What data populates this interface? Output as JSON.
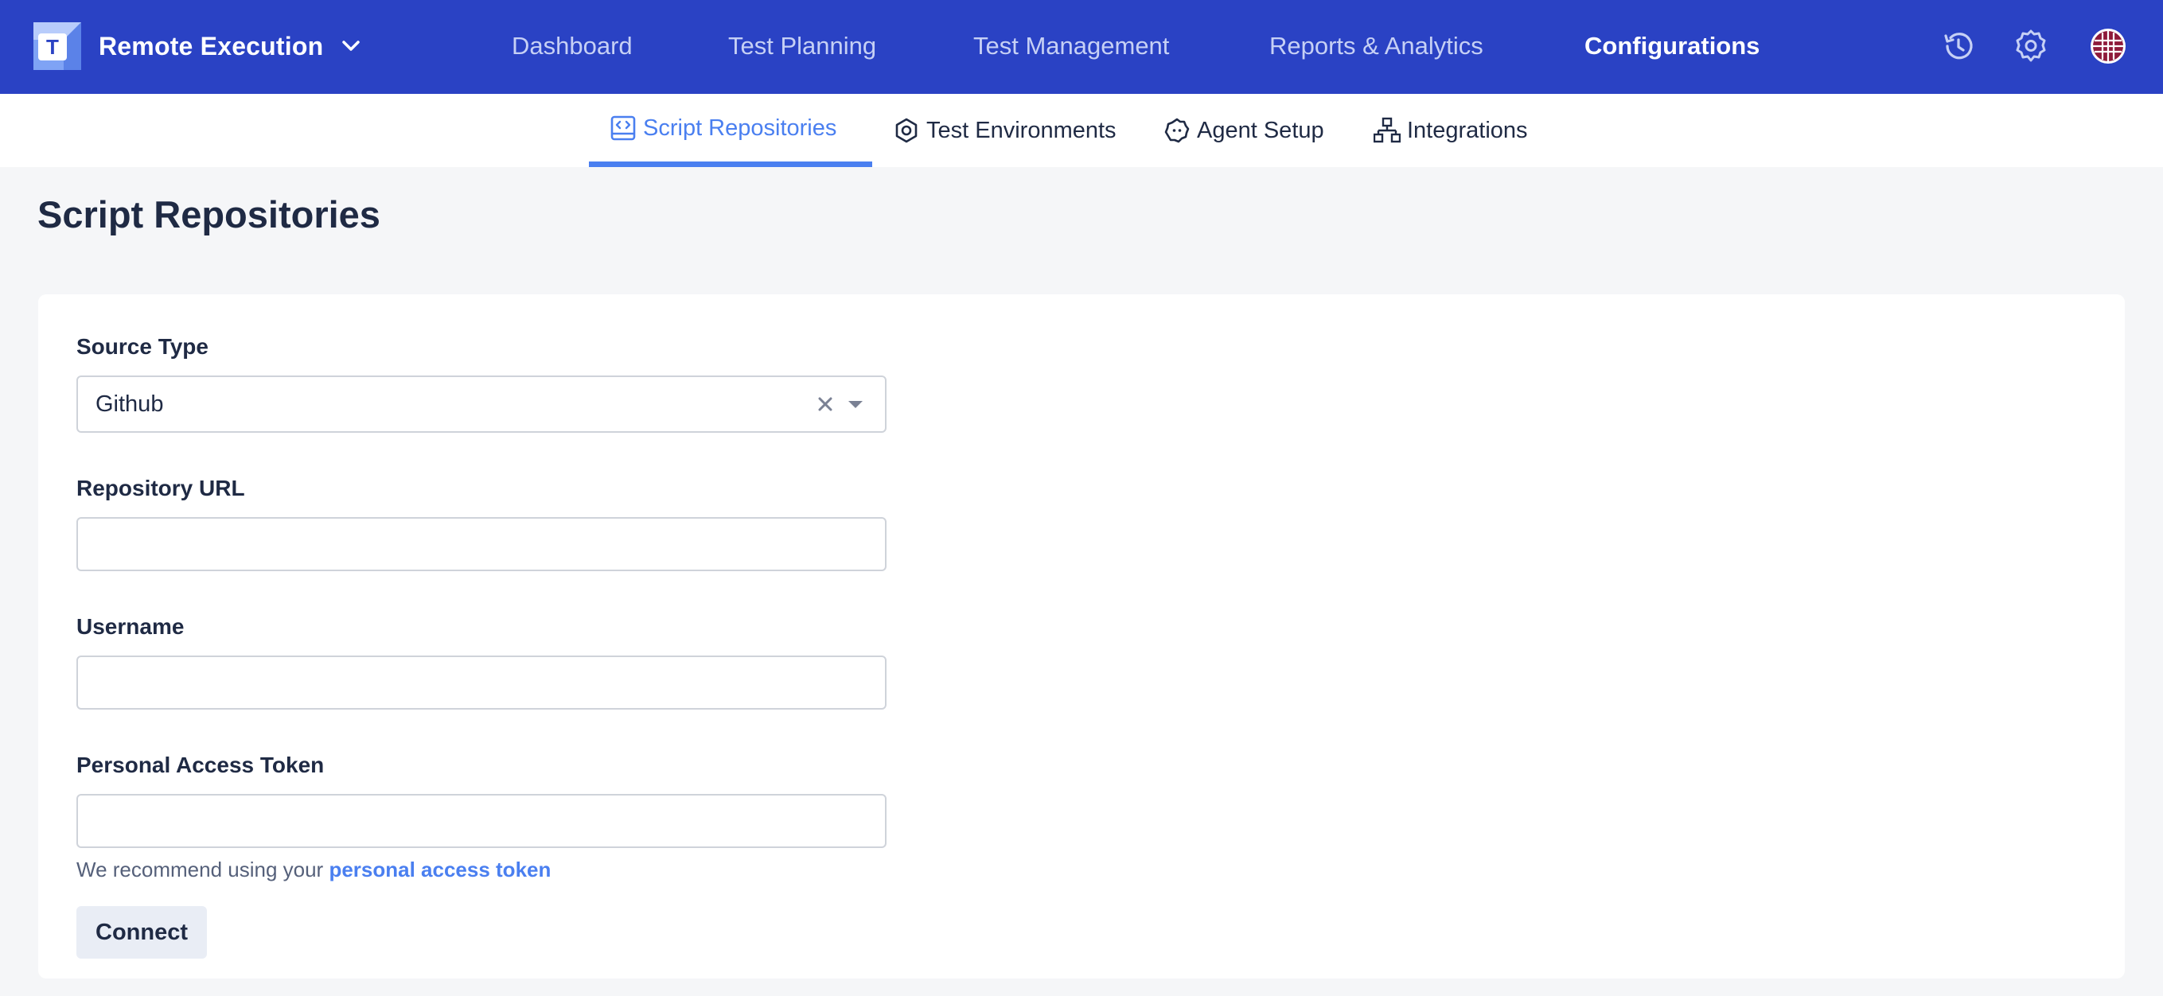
{
  "topbar": {
    "app_name": "Remote Execution",
    "nav": [
      {
        "label": "Dashboard"
      },
      {
        "label": "Test Planning"
      },
      {
        "label": "Test Management"
      },
      {
        "label": "Reports & Analytics"
      },
      {
        "label": "Configurations",
        "active": true
      }
    ],
    "icons": [
      "history-icon",
      "settings-gear-icon",
      "user-avatar"
    ],
    "colors": {
      "background": "#2a42c4",
      "active_text": "#ffffff",
      "inactive_text": "#c6d0f5"
    }
  },
  "subnav": {
    "tabs": [
      {
        "label": "Script Repositories",
        "icon": "code-window-icon",
        "active": true
      },
      {
        "label": "Test Environments",
        "icon": "hexagon-icon"
      },
      {
        "label": "Agent Setup",
        "icon": "agent-gear-icon"
      },
      {
        "label": "Integrations",
        "icon": "network-tree-icon"
      }
    ],
    "accent": "#4a7ff0"
  },
  "page": {
    "title": "Script Repositories"
  },
  "form": {
    "source_type": {
      "label": "Source Type",
      "value": "Github"
    },
    "repository_url": {
      "label": "Repository URL",
      "value": ""
    },
    "username": {
      "label": "Username",
      "value": ""
    },
    "token": {
      "label": "Personal Access Token",
      "value": ""
    },
    "helper_text": "We recommend using your",
    "helper_link": "personal access token",
    "connect_label": "Connect"
  }
}
